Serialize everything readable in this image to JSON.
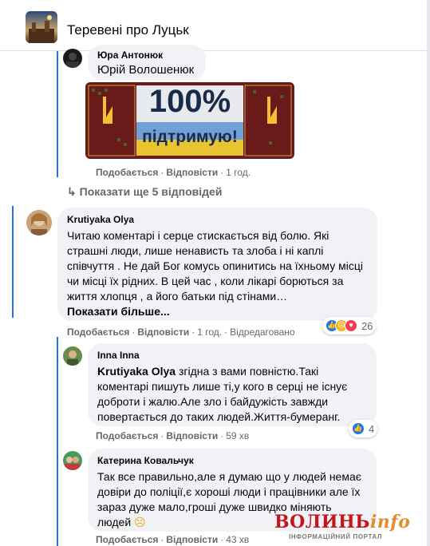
{
  "group": {
    "title": "Теревені про Луцьк"
  },
  "comment1": {
    "author": "Юра Антонюк",
    "text": "Юрій Волошенюк",
    "sticker": {
      "big_text": "100%",
      "small_text": "підтримую!"
    },
    "actions": {
      "like": "Подобається",
      "reply": "Відповісти",
      "time": "1 год."
    }
  },
  "show_more_replies": "Показати ще 5 відповідей",
  "comment2": {
    "author": "Krutiyaka Olya",
    "text": "Читаю коментарі і серце стискається від болю. Які страшні люди, лише ненависть та злоба і ні каплі співчуття . Не дай Бог комусь опинитись на їхньому місці чи місці їх рідних. В цей час , коли лікарі борються за життя хлопця , а його батьки під стінами…",
    "see_more": "Показати більше...",
    "actions": {
      "like": "Подобається",
      "reply": "Відповісти",
      "time": "1 год.",
      "edited": "Відредаговано"
    },
    "reactions": {
      "icons": [
        "like",
        "sad",
        "love"
      ],
      "count": "26"
    }
  },
  "reply1": {
    "author": "Inna Inna",
    "mention": "Krutiyaka Olya",
    "text": " згідна з вами повністю.Такі коментарі пишуть лише ті,у кого в серці не існує доброти і жалю.Але зло і байдужість завжди повертається до таких людей.Життя-бумеранг.",
    "actions": {
      "like": "Подобається",
      "reply": "Відповісти",
      "time": "59 хв"
    },
    "reactions": {
      "icons": [
        "like"
      ],
      "count": "4"
    }
  },
  "reply2": {
    "author": "Катерина Ковальчук",
    "text": "Так все правильно,але я думаю що у людей немає довіри до поліції,є хороші люди і працівники але їх зараз дуже мало,гроші дуже швидко міняють людей",
    "emoji": "☹",
    "actions": {
      "like": "Подобається",
      "reply": "Відповісти",
      "time": "43 хв"
    }
  },
  "watermark": {
    "brand": "ВОЛИНЬ",
    "brand_suffix": "info",
    "subtitle": "ІНФОРМАЦІЙНИЙ ПОРТАЛ"
  },
  "colors": {
    "thread_line": "#1b74e4",
    "bubble": "#f0f2f5",
    "secondary_text": "#65676b",
    "like": "#1877f2",
    "sad": "#f7b125",
    "love": "#f33e58"
  }
}
